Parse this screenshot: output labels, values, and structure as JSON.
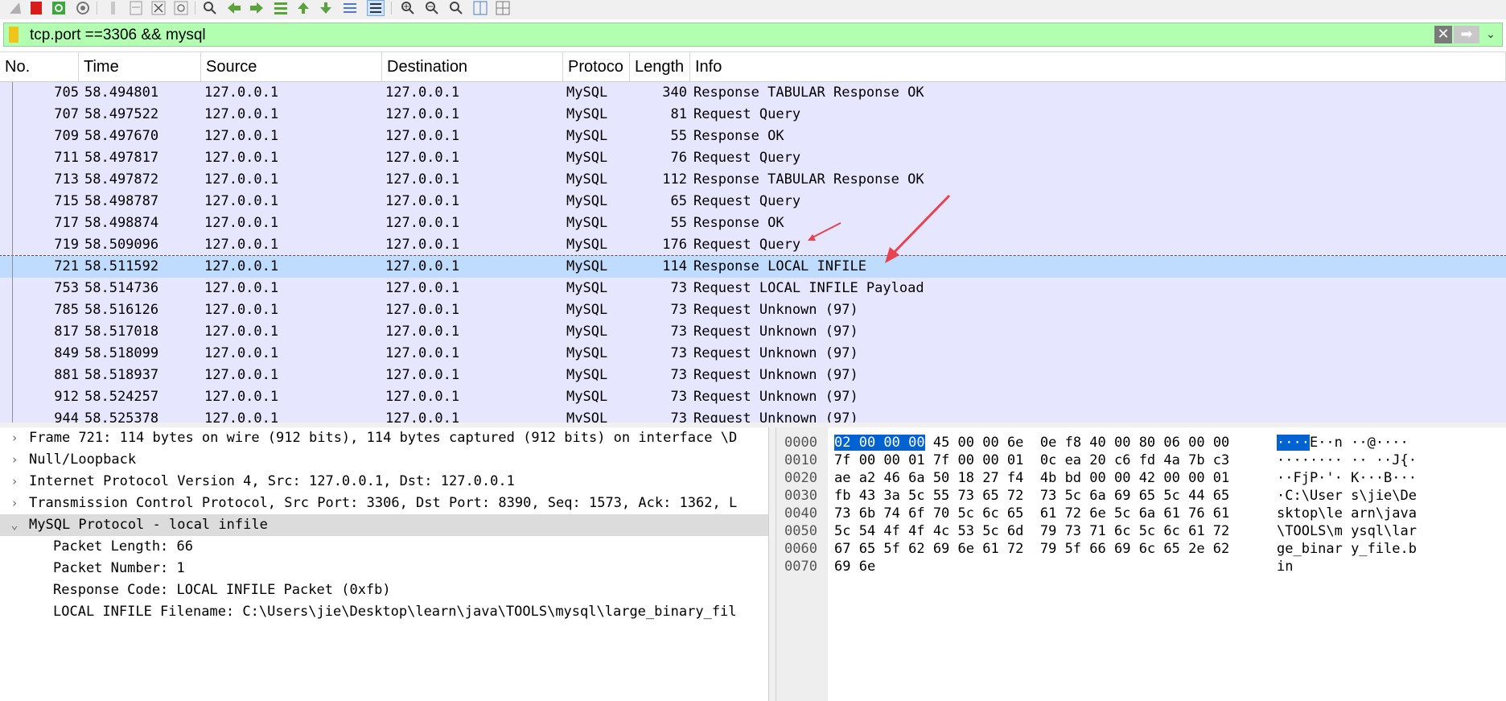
{
  "toolbar": {
    "icons": [
      "shark-fin-icon",
      "stop-icon",
      "restart-icon",
      "options-icon",
      "open-icon",
      "save-icon",
      "close-icon",
      "reload-icon",
      "find-icon",
      "back-icon",
      "forward-icon",
      "go-to-packet-icon",
      "first-packet-icon",
      "last-packet-icon",
      "autoscroll-icon",
      "colorize-icon",
      "zoom-in-icon",
      "zoom-out-icon",
      "zoom-normal-icon",
      "resize-columns-icon",
      "coloring-rules-icon"
    ]
  },
  "filter": {
    "value": "tcp.port ==3306 && mysql"
  },
  "packet_list": {
    "columns": [
      "No.",
      "Time",
      "Source",
      "Destination",
      "Protoco",
      "Length",
      "Info"
    ],
    "rows": [
      {
        "no": "705",
        "time": "58.494801",
        "src": "127.0.0.1",
        "dst": "127.0.0.1",
        "proto": "MySQL",
        "len": "340",
        "info": "Response TABULAR Response  OK"
      },
      {
        "no": "707",
        "time": "58.497522",
        "src": "127.0.0.1",
        "dst": "127.0.0.1",
        "proto": "MySQL",
        "len": "81",
        "info": "Request Query"
      },
      {
        "no": "709",
        "time": "58.497670",
        "src": "127.0.0.1",
        "dst": "127.0.0.1",
        "proto": "MySQL",
        "len": "55",
        "info": "Response  OK"
      },
      {
        "no": "711",
        "time": "58.497817",
        "src": "127.0.0.1",
        "dst": "127.0.0.1",
        "proto": "MySQL",
        "len": "76",
        "info": "Request Query"
      },
      {
        "no": "713",
        "time": "58.497872",
        "src": "127.0.0.1",
        "dst": "127.0.0.1",
        "proto": "MySQL",
        "len": "112",
        "info": "Response TABULAR Response  OK"
      },
      {
        "no": "715",
        "time": "58.498787",
        "src": "127.0.0.1",
        "dst": "127.0.0.1",
        "proto": "MySQL",
        "len": "65",
        "info": "Request Query"
      },
      {
        "no": "717",
        "time": "58.498874",
        "src": "127.0.0.1",
        "dst": "127.0.0.1",
        "proto": "MySQL",
        "len": "55",
        "info": "Response  OK"
      },
      {
        "no": "719",
        "time": "58.509096",
        "src": "127.0.0.1",
        "dst": "127.0.0.1",
        "proto": "MySQL",
        "len": "176",
        "info": "Request Query"
      },
      {
        "no": "721",
        "time": "58.511592",
        "src": "127.0.0.1",
        "dst": "127.0.0.1",
        "proto": "MySQL",
        "len": "114",
        "info": "Response  LOCAL INFILE",
        "selected": true
      },
      {
        "no": "753",
        "time": "58.514736",
        "src": "127.0.0.1",
        "dst": "127.0.0.1",
        "proto": "MySQL",
        "len": "73",
        "info": "Request LOCAL INFILE Payload"
      },
      {
        "no": "785",
        "time": "58.516126",
        "src": "127.0.0.1",
        "dst": "127.0.0.1",
        "proto": "MySQL",
        "len": "73",
        "info": "Request Unknown (97)"
      },
      {
        "no": "817",
        "time": "58.517018",
        "src": "127.0.0.1",
        "dst": "127.0.0.1",
        "proto": "MySQL",
        "len": "73",
        "info": "Request Unknown (97)"
      },
      {
        "no": "849",
        "time": "58.518099",
        "src": "127.0.0.1",
        "dst": "127.0.0.1",
        "proto": "MySQL",
        "len": "73",
        "info": "Request Unknown (97)"
      },
      {
        "no": "881",
        "time": "58.518937",
        "src": "127.0.0.1",
        "dst": "127.0.0.1",
        "proto": "MySQL",
        "len": "73",
        "info": "Request Unknown (97)"
      },
      {
        "no": "912",
        "time": "58.524257",
        "src": "127.0.0.1",
        "dst": "127.0.0.1",
        "proto": "MySQL",
        "len": "73",
        "info": "Request Unknown (97)"
      },
      {
        "no": "944",
        "time": "58.525378",
        "src": "127.0.0.1",
        "dst": "127.0.0.1",
        "proto": "MySQL",
        "len": "73",
        "info": "Request Unknown (97)"
      }
    ]
  },
  "details": [
    {
      "arrow": ">",
      "text": "Frame 721: 114 bytes on wire (912 bits), 114 bytes captured (912 bits) on interface \\D"
    },
    {
      "arrow": ">",
      "text": "Null/Loopback"
    },
    {
      "arrow": ">",
      "text": "Internet Protocol Version 4, Src: 127.0.0.1, Dst: 127.0.0.1"
    },
    {
      "arrow": ">",
      "text": "Transmission Control Protocol, Src Port: 3306, Dst Port: 8390, Seq: 1573, Ack: 1362, L"
    },
    {
      "arrow": "v",
      "text": "MySQL Protocol - local infile",
      "selected": true
    },
    {
      "child": true,
      "text": "Packet Length: 66"
    },
    {
      "child": true,
      "text": "Packet Number: 1"
    },
    {
      "child": true,
      "text": "Response Code: LOCAL INFILE Packet (0xfb)"
    },
    {
      "child": true,
      "text": "LOCAL INFILE Filename: C:\\Users\\jie\\Desktop\\learn\\java\\TOOLS\\mysql\\large_binary_fil"
    }
  ],
  "bytes": [
    {
      "off": "0000",
      "hex_hl": "02 00 00 00",
      "hex": " 45 00 00 6e  0e f8 40 00 80 06 00 00",
      "asc_hl": "····",
      "asc": "E··n ··@····"
    },
    {
      "off": "0010",
      "hex_hl": "",
      "hex": "7f 00 00 01 7f 00 00 01  0c ea 20 c6 fd 4a 7b c3",
      "asc_hl": "",
      "asc": "········ ·· ··J{·"
    },
    {
      "off": "0020",
      "hex_hl": "",
      "hex": "ae a2 46 6a 50 18 27 f4  4b bd 00 00 42 00 00 01",
      "asc_hl": "",
      "asc": "··FjP·'· K···B···"
    },
    {
      "off": "0030",
      "hex_hl": "",
      "hex": "fb 43 3a 5c 55 73 65 72  73 5c 6a 69 65 5c 44 65",
      "asc_hl": "",
      "asc": "·C:\\User s\\jie\\De"
    },
    {
      "off": "0040",
      "hex_hl": "",
      "hex": "73 6b 74 6f 70 5c 6c 65  61 72 6e 5c 6a 61 76 61",
      "asc_hl": "",
      "asc": "sktop\\le arn\\java"
    },
    {
      "off": "0050",
      "hex_hl": "",
      "hex": "5c 54 4f 4f 4c 53 5c 6d  79 73 71 6c 5c 6c 61 72",
      "asc_hl": "",
      "asc": "\\TOOLS\\m ysql\\lar"
    },
    {
      "off": "0060",
      "hex_hl": "",
      "hex": "67 65 5f 62 69 6e 61 72  79 5f 66 69 6c 65 2e 62",
      "asc_hl": "",
      "asc": "ge_binar y_file.b"
    },
    {
      "off": "0070",
      "hex_hl": "",
      "hex": "69 6e",
      "asc_hl": "",
      "asc": "in"
    }
  ],
  "colors": {
    "row_bg": "#e7e6ff",
    "row_selected": "#bfdcff",
    "filter_bg": "#b2ffb2",
    "byte_highlight": "#0063d1",
    "annotation_arrow": "#e8414f"
  }
}
